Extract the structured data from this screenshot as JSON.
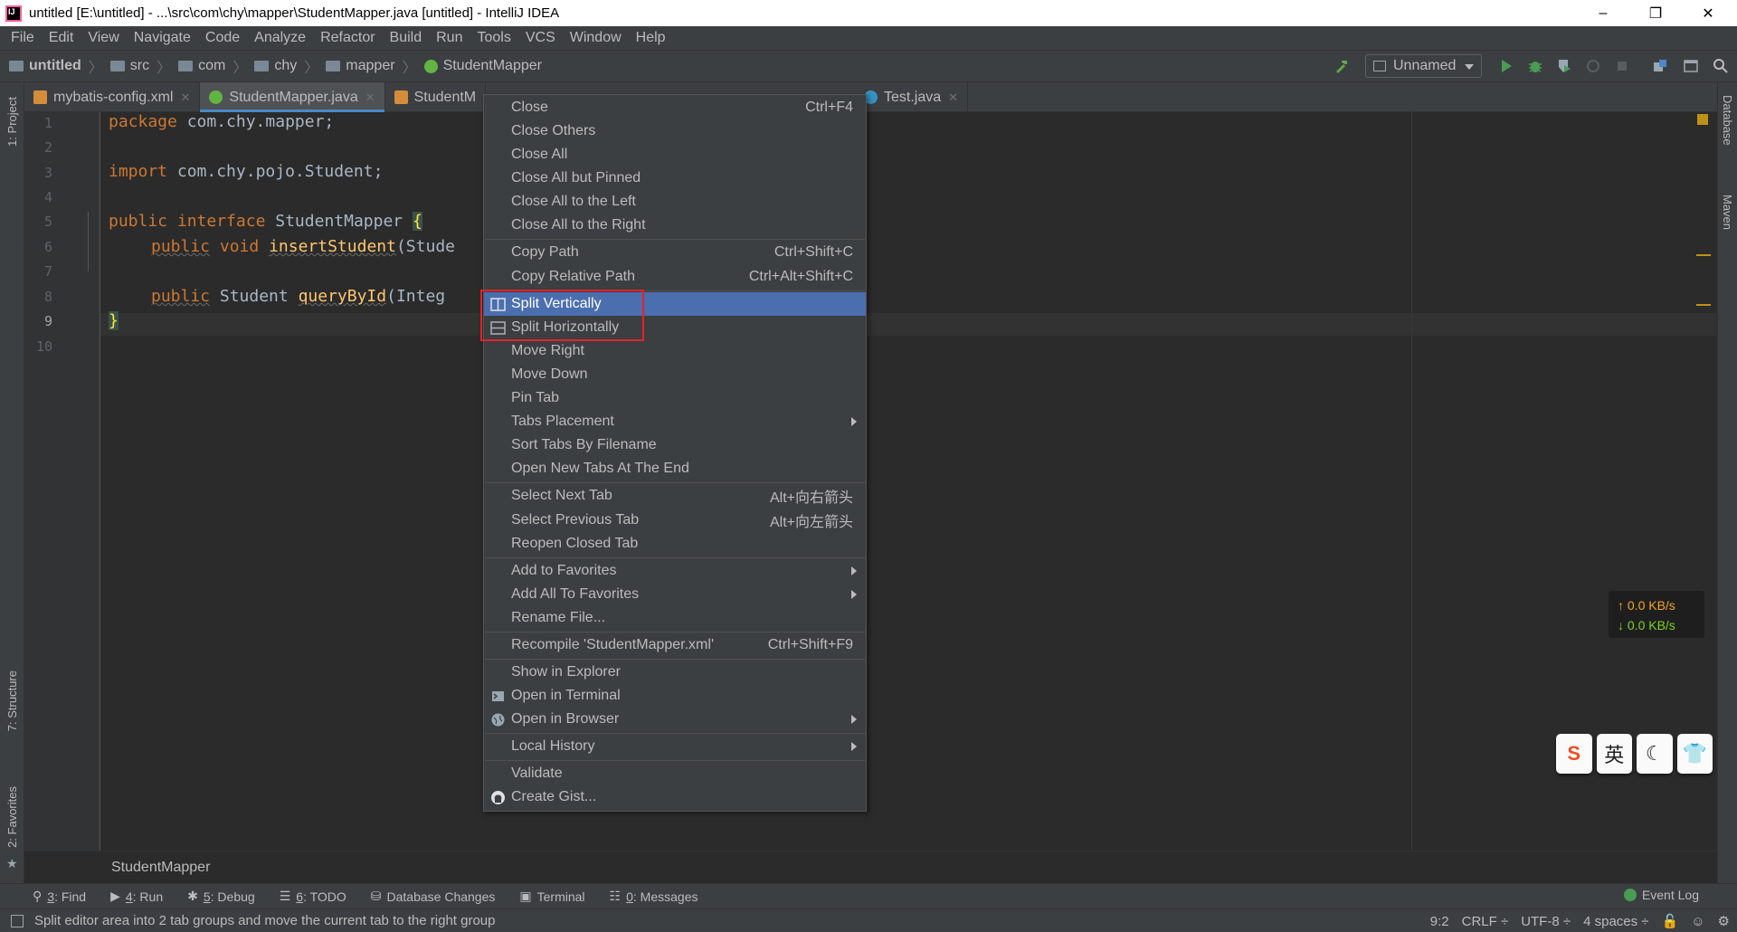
{
  "window": {
    "title": "untitled [E:\\untitled] - ...\\src\\com\\chy\\mapper\\StudentMapper.java [untitled] - IntelliJ IDEA"
  },
  "menubar": [
    "File",
    "Edit",
    "View",
    "Navigate",
    "Code",
    "Analyze",
    "Refactor",
    "Build",
    "Run",
    "Tools",
    "VCS",
    "Window",
    "Help"
  ],
  "breadcrumb": [
    "untitled",
    "src",
    "com",
    "chy",
    "mapper",
    "StudentMapper"
  ],
  "run_config": "Unnamed",
  "tabs": [
    {
      "label": "mybatis-config.xml",
      "type": "xml",
      "active": false
    },
    {
      "label": "StudentMapper.java",
      "type": "interface",
      "active": true
    },
    {
      "label": "StudentM",
      "type": "xml",
      "active": false
    },
    {
      "label": "",
      "type": "class",
      "active": false
    },
    {
      "label": "",
      "type": "class",
      "active": false
    },
    {
      "label": "Test.java",
      "type": "class",
      "active": false
    }
  ],
  "editor": {
    "line_numbers": [
      "1",
      "2",
      "3",
      "4",
      "5",
      "6",
      "7",
      "8",
      "9",
      "10"
    ],
    "current_line": "9",
    "code": {
      "l1_kw": "package",
      "l1_rest": " com.chy.mapper;",
      "l3_kw": "import",
      "l3_rest": " com.chy.pojo.Student;",
      "l5_kw1": "public",
      "l5_kw2": "interface",
      "l5_name": " StudentMapper ",
      "l5_brace": "{",
      "l6_kw1": "public",
      "l6_kw2": "void",
      "l6_fn": "insertStudent",
      "l6_rest": "(Stude",
      "l8_kw1": "public",
      "l8_type": " Student ",
      "l8_fn": "queryById",
      "l8_rest": "(Integ",
      "l9_brace": "}"
    },
    "footer_breadcrumb": "StudentMapper"
  },
  "context_menu": {
    "items": [
      {
        "label": "Close",
        "shortcut": "Ctrl+F4"
      },
      {
        "label": "Close Others"
      },
      {
        "label": "Close All"
      },
      {
        "label": "Close All but Pinned"
      },
      {
        "label": "Close All to the Left"
      },
      {
        "label": "Close All to the Right"
      },
      {
        "label": "Copy Path",
        "shortcut": "Ctrl+Shift+C"
      },
      {
        "label": "Copy Relative Path",
        "shortcut": "Ctrl+Alt+Shift+C"
      },
      {
        "label": "Split Vertically",
        "selected": true
      },
      {
        "label": "Split Horizontally"
      },
      {
        "label": "Move Right"
      },
      {
        "label": "Move Down"
      },
      {
        "label": "Pin Tab"
      },
      {
        "label": "Tabs Placement",
        "submenu": true
      },
      {
        "label": "Sort Tabs By Filename"
      },
      {
        "label": "Open New Tabs At The End"
      },
      {
        "label": "Select Next Tab",
        "shortcut": "Alt+向右箭头"
      },
      {
        "label": "Select Previous Tab",
        "shortcut": "Alt+向左箭头"
      },
      {
        "label": "Reopen Closed Tab"
      },
      {
        "label": "Add to Favorites",
        "submenu": true
      },
      {
        "label": "Add All To Favorites",
        "submenu": true
      },
      {
        "label": "Rename File..."
      },
      {
        "label": "Recompile 'StudentMapper.xml'",
        "shortcut": "Ctrl+Shift+F9"
      },
      {
        "label": "Show in Explorer"
      },
      {
        "label": "Open in Terminal"
      },
      {
        "label": "Open in Browser",
        "submenu": true
      },
      {
        "label": "Local History",
        "submenu": true
      },
      {
        "label": "Validate"
      },
      {
        "label": "Create Gist..."
      }
    ]
  },
  "left_strip": [
    "1: Project",
    "7: Structure",
    "2: Favorites"
  ],
  "right_strip": [
    "Database",
    "Maven"
  ],
  "tool_windows": [
    {
      "num": "3",
      "label": ": Find"
    },
    {
      "num": "4",
      "label": ": Run"
    },
    {
      "num": "5",
      "label": ": Debug"
    },
    {
      "num": "6",
      "label": ": TODO"
    },
    {
      "num": "",
      "label": "Database Changes"
    },
    {
      "num": "",
      "label": "Terminal"
    },
    {
      "num": "0",
      "label": ": Messages"
    }
  ],
  "event_log": "Event Log",
  "status": {
    "message": "Split editor area into 2 tab groups and move the current tab to the right group",
    "position": "9:2",
    "line_sep": "CRLF ÷",
    "encoding": "UTF-8 ÷",
    "indent": "4 spaces ÷"
  },
  "netspeed": {
    "up": "↑ 0.0 KB/s",
    "down": "↓ 0.0 KB/s"
  },
  "ime": {
    "lang": "英"
  },
  "colors": {
    "accent": "#4b6eaf",
    "highlight_box": "#e5212a",
    "keyword": "#cc7832"
  }
}
